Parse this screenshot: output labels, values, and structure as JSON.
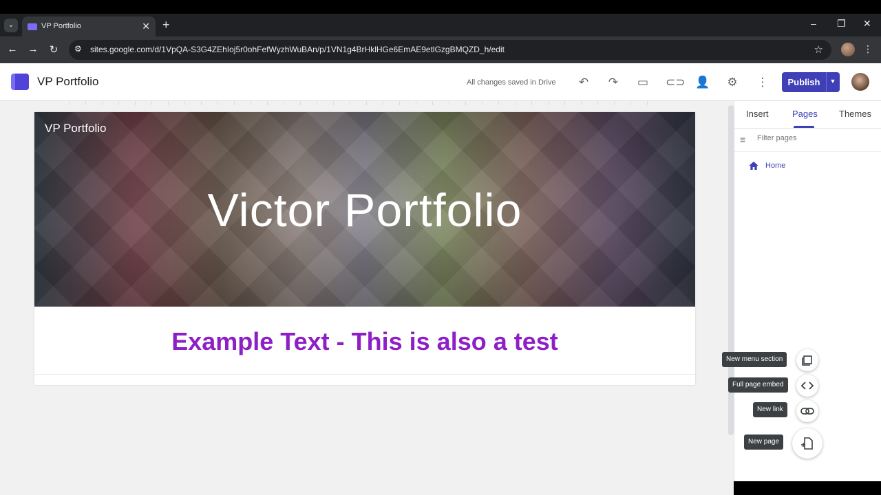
{
  "browser": {
    "tab_title": "VP Portfolio",
    "tab_close": "✕",
    "new_tab": "+",
    "url": "sites.google.com/d/1VpQA-S3G4ZEhIoj5r0ohFefWyzhWuBAn/p/1VN1g4BrHklHGe6EmAE9etlGzgBMQZD_h/edit",
    "icons": [
      "tab-search-icon",
      "back-icon",
      "forward-icon",
      "reload-icon",
      "site-info-icon",
      "bookmark-star-icon",
      "kebab-menu-icon",
      "minimize-icon",
      "restore-icon",
      "close-window-icon"
    ]
  },
  "header": {
    "site_name": "VP Portfolio",
    "save_status": "All changes saved in Drive",
    "publish_label": "Publish",
    "icons": [
      "undo-icon",
      "redo-icon",
      "preview-icon",
      "copy-link-icon",
      "share-icon",
      "settings-icon",
      "more-icon"
    ]
  },
  "page": {
    "hero_site_name": "VP Portfolio",
    "hero_title": "Victor Portfolio",
    "body_text": "Example Text - This is also a test",
    "body_text_color": "#8e1fc6"
  },
  "panel": {
    "tabs": [
      {
        "label": "Insert"
      },
      {
        "label": "Pages"
      },
      {
        "label": "Themes"
      }
    ],
    "active_tab": "Pages",
    "filter_placeholder": "Filter pages",
    "pages": [
      {
        "label": "Home"
      }
    ]
  },
  "fab_menu": {
    "items": [
      {
        "label": "New menu section",
        "icon": "menu-section-icon"
      },
      {
        "label": "Full page embed",
        "icon": "embed-code-icon"
      },
      {
        "label": "New link",
        "icon": "link-icon"
      },
      {
        "label": "New page",
        "icon": "new-page-icon"
      }
    ]
  },
  "colors": {
    "accent": "#3f3fb8",
    "browser_dark": "#202124"
  }
}
